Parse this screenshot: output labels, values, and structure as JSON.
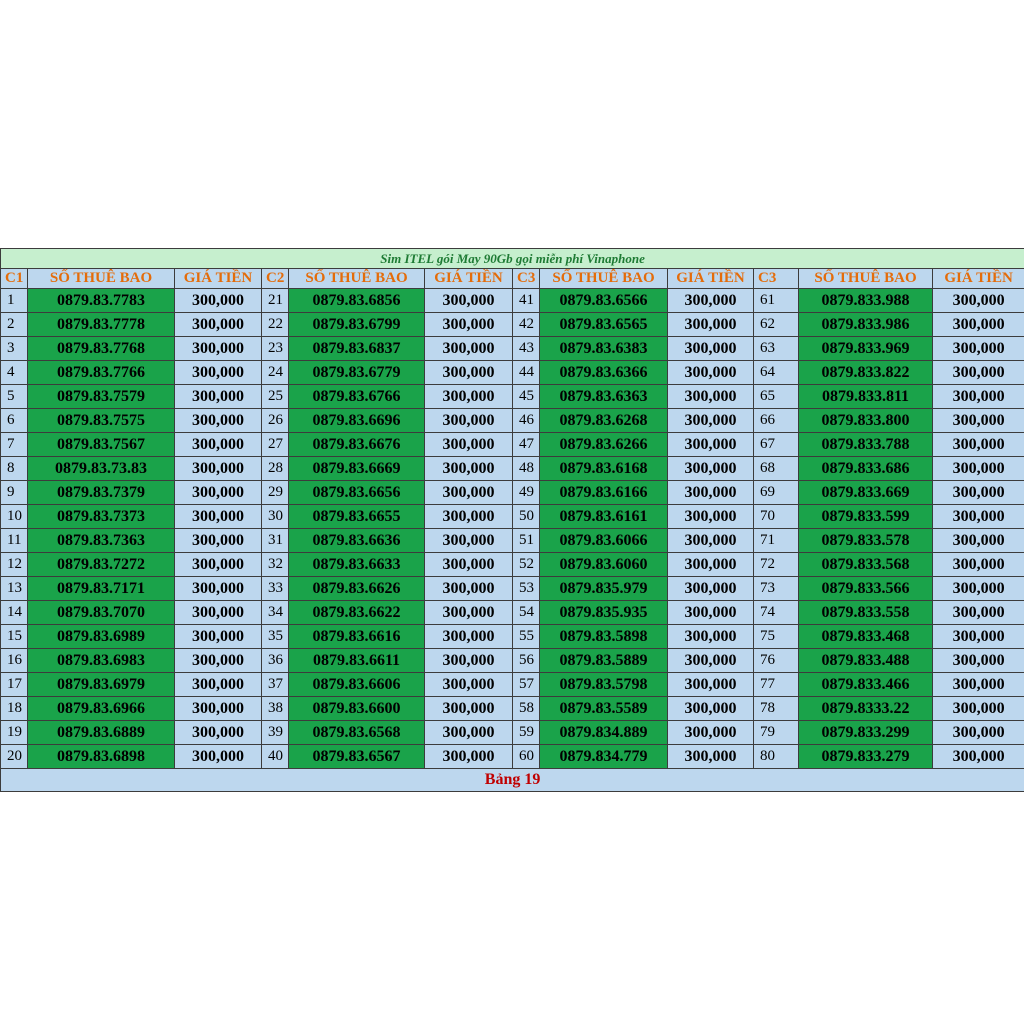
{
  "title": "Sim ITEL gói May 90Gb gọi miễn phí Vinaphone",
  "headers": [
    "C1",
    "SỐ THUÊ BAO",
    "GIÁ TIỀN",
    "C2",
    "SỐ THUÊ BAO",
    "GIÁ TIỀN",
    "C3",
    "SỐ THUÊ BAO",
    "GIÁ TIỀN",
    "C3",
    "SỐ THUÊ BAO",
    "GIÁ TIỀN"
  ],
  "rows": [
    [
      "1",
      "0879.83.7783",
      "300,000",
      "21",
      "0879.83.6856",
      "300,000",
      "41",
      "0879.83.6566",
      "300,000",
      "61",
      "0879.833.988",
      "300,000"
    ],
    [
      "2",
      "0879.83.7778",
      "300,000",
      "22",
      "0879.83.6799",
      "300,000",
      "42",
      "0879.83.6565",
      "300,000",
      "62",
      "0879.833.986",
      "300,000"
    ],
    [
      "3",
      "0879.83.7768",
      "300,000",
      "23",
      "0879.83.6837",
      "300,000",
      "43",
      "0879.83.6383",
      "300,000",
      "63",
      "0879.833.969",
      "300,000"
    ],
    [
      "4",
      "0879.83.7766",
      "300,000",
      "24",
      "0879.83.6779",
      "300,000",
      "44",
      "0879.83.6366",
      "300,000",
      "64",
      "0879.833.822",
      "300,000"
    ],
    [
      "5",
      "0879.83.7579",
      "300,000",
      "25",
      "0879.83.6766",
      "300,000",
      "45",
      "0879.83.6363",
      "300,000",
      "65",
      "0879.833.811",
      "300,000"
    ],
    [
      "6",
      "0879.83.7575",
      "300,000",
      "26",
      "0879.83.6696",
      "300,000",
      "46",
      "0879.83.6268",
      "300,000",
      "66",
      "0879.833.800",
      "300,000"
    ],
    [
      "7",
      "0879.83.7567",
      "300,000",
      "27",
      "0879.83.6676",
      "300,000",
      "47",
      "0879.83.6266",
      "300,000",
      "67",
      "0879.833.788",
      "300,000"
    ],
    [
      "8",
      "0879.83.73.83",
      "300,000",
      "28",
      "0879.83.6669",
      "300,000",
      "48",
      "0879.83.6168",
      "300,000",
      "68",
      "0879.833.686",
      "300,000"
    ],
    [
      "9",
      "0879.83.7379",
      "300,000",
      "29",
      "0879.83.6656",
      "300,000",
      "49",
      "0879.83.6166",
      "300,000",
      "69",
      "0879.833.669",
      "300,000"
    ],
    [
      "10",
      "0879.83.7373",
      "300,000",
      "30",
      "0879.83.6655",
      "300,000",
      "50",
      "0879.83.6161",
      "300,000",
      "70",
      "0879.833.599",
      "300,000"
    ],
    [
      "11",
      "0879.83.7363",
      "300,000",
      "31",
      "0879.83.6636",
      "300,000",
      "51",
      "0879.83.6066",
      "300,000",
      "71",
      "0879.833.578",
      "300,000"
    ],
    [
      "12",
      "0879.83.7272",
      "300,000",
      "32",
      "0879.83.6633",
      "300,000",
      "52",
      "0879.83.6060",
      "300,000",
      "72",
      "0879.833.568",
      "300,000"
    ],
    [
      "13",
      "0879.83.7171",
      "300,000",
      "33",
      "0879.83.6626",
      "300,000",
      "53",
      "0879.835.979",
      "300,000",
      "73",
      "0879.833.566",
      "300,000"
    ],
    [
      "14",
      "0879.83.7070",
      "300,000",
      "34",
      "0879.83.6622",
      "300,000",
      "54",
      "0879.835.935",
      "300,000",
      "74",
      "0879.833.558",
      "300,000"
    ],
    [
      "15",
      "0879.83.6989",
      "300,000",
      "35",
      "0879.83.6616",
      "300,000",
      "55",
      "0879.83.5898",
      "300,000",
      "75",
      "0879.833.468",
      "300,000"
    ],
    [
      "16",
      "0879.83.6983",
      "300,000",
      "36",
      "0879.83.6611",
      "300,000",
      "56",
      "0879.83.5889",
      "300,000",
      "76",
      "0879.833.488",
      "300,000"
    ],
    [
      "17",
      "0879.83.6979",
      "300,000",
      "37",
      "0879.83.6606",
      "300,000",
      "57",
      "0879.83.5798",
      "300,000",
      "77",
      "0879.833.466",
      "300,000"
    ],
    [
      "18",
      "0879.83.6966",
      "300,000",
      "38",
      "0879.83.6600",
      "300,000",
      "58",
      "0879.83.5589",
      "300,000",
      "78",
      "0879.8333.22",
      "300,000"
    ],
    [
      "19",
      "0879.83.6889",
      "300,000",
      "39",
      "0879.83.6568",
      "300,000",
      "59",
      "0879.834.889",
      "300,000",
      "79",
      "0879.833.299",
      "300,000"
    ],
    [
      "20",
      "0879.83.6898",
      "300,000",
      "40",
      "0879.83.6567",
      "300,000",
      "60",
      "0879.834.779",
      "300,000",
      "80",
      "0879.833.279",
      "300,000"
    ]
  ],
  "footer": "Bảng 19",
  "colors": {
    "title_bg": "#c6efce",
    "title_text": "#1e7b34",
    "header_bg": "#bdd7ee",
    "header_text": "#e46c0a",
    "number_bg": "#1aa34a",
    "footer_text": "#c00000"
  }
}
